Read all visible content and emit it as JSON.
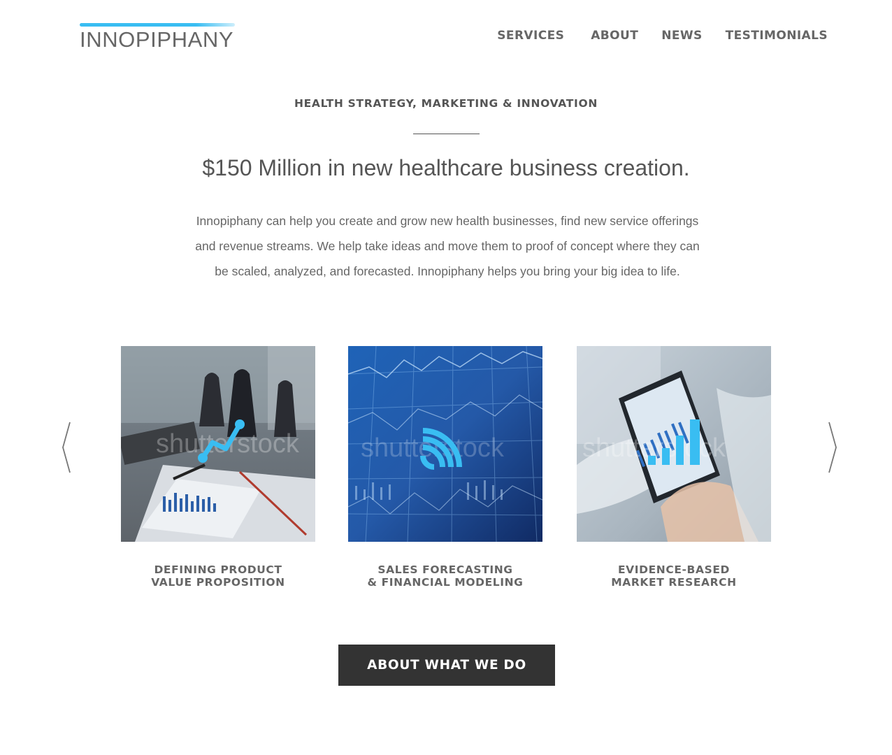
{
  "header": {
    "logo_text": "INNOPIPHANY",
    "nav": [
      "SERVICES",
      "ABOUT",
      "NEWS",
      "TESTIMONIALS"
    ]
  },
  "hero": {
    "eyebrow": "HEALTH STRATEGY, MARKETING & INNOVATION",
    "headline": "$150 Million in new healthcare business creation.",
    "body": "Innopiphany can help you create and grow new health businesses, find new service offerings and revenue streams. We help take ideas and move them to proof of concept where they can be scaled, analyzed, and forecasted. Innopiphany helps you bring your big idea to life."
  },
  "carousel": {
    "prev_icon": "chevron-left-icon",
    "next_icon": "chevron-right-icon",
    "items": [
      {
        "title_line1": "DEFINING PRODUCT",
        "title_line2": "VALUE PROPOSITION",
        "icon": "line-chart-icon",
        "watermark": "shutterstock"
      },
      {
        "title_line1": "SALES FORECASTING",
        "title_line2": "& FINANCIAL MODELING",
        "icon": "signal-waves-icon",
        "watermark": "shutterstock"
      },
      {
        "title_line1": "EVIDENCE-BASED",
        "title_line2": "MARKET RESEARCH",
        "icon": "bar-chart-icon",
        "watermark": "shutterstock"
      }
    ]
  },
  "cta": {
    "label": "ABOUT WHAT WE DO"
  },
  "colors": {
    "accent": "#39bdf2",
    "button_bg": "#333333",
    "text": "#555555"
  }
}
